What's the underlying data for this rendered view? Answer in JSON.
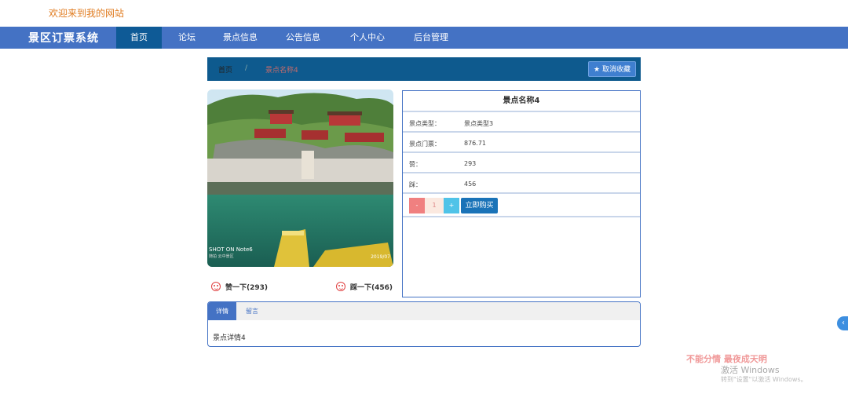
{
  "header": {
    "welcome": "欢迎来到我的网站"
  },
  "nav": {
    "brand": "景区订票系统",
    "items": [
      {
        "label": "首页"
      },
      {
        "label": "论坛"
      },
      {
        "label": "景点信息"
      },
      {
        "label": "公告信息"
      },
      {
        "label": "个人中心"
      },
      {
        "label": "后台管理"
      }
    ]
  },
  "breadcrumb": {
    "home": "首页",
    "separator": "/",
    "current": "景点名称4"
  },
  "favorite_button": {
    "label": "取消收藏",
    "icon": "star-icon"
  },
  "photo": {
    "caption": "SHOT ON Note6",
    "sub_caption": "随拍 云中景区",
    "date": "2019/07"
  },
  "votes": {
    "like_label": "赞一下(293)",
    "dislike_label": "踩一下(456)",
    "icon": "smiley-face-icon"
  },
  "info": {
    "title": "景点名称4",
    "rows": [
      {
        "key": "景点类型：",
        "value": "景点类型3"
      },
      {
        "key": "景点门票：",
        "value": "876.71"
      },
      {
        "key": "赞：",
        "value": "293"
      },
      {
        "key": "踩：",
        "value": "456"
      }
    ],
    "quantity": {
      "minus": "-",
      "value": "1",
      "plus": "+"
    },
    "buy_label": "立即购买"
  },
  "tabs": {
    "items": [
      {
        "label": "详情"
      },
      {
        "label": "留言"
      }
    ],
    "content": "景点详情4"
  },
  "side_button": {
    "label": "‹"
  },
  "watermark": {
    "line1": "不能分情 最夜成天明",
    "line2": "激活 Windows",
    "line3": "转到\"设置\"以激活 Windows。"
  },
  "colors": {
    "nav_bg": "#4472c4",
    "nav_active": "#0e5a96",
    "welcome_text": "#e07b1f",
    "buy_button": "#1a73b8",
    "accent_red": "#e04040"
  }
}
